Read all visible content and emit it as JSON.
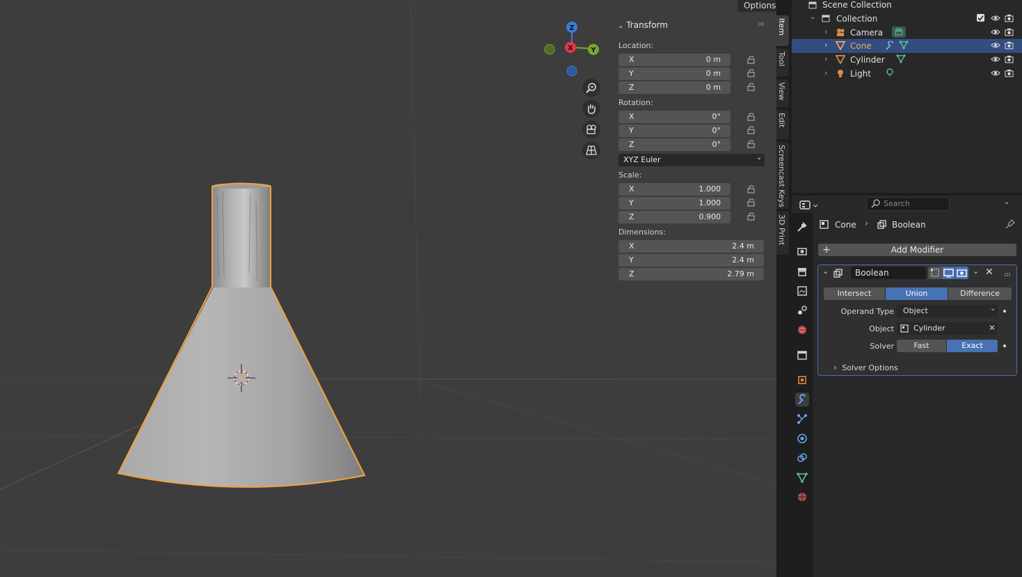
{
  "viewport": {
    "options_label": "Options",
    "gizmo": {
      "z": "Z",
      "x": "X",
      "y": "Y"
    }
  },
  "transform": {
    "title": "Transform",
    "location": {
      "label": "Location:",
      "x": "0 m",
      "y": "0 m",
      "z": "0 m"
    },
    "rotation": {
      "label": "Rotation:",
      "x": "0°",
      "y": "0°",
      "z": "0°",
      "mode": "XYZ Euler"
    },
    "scale": {
      "label": "Scale:",
      "x": "1.000",
      "y": "1.000",
      "z": "0.900"
    },
    "dimensions": {
      "label": "Dimensions:",
      "x": "2.4 m",
      "y": "2.4 m",
      "z": "2.79 m"
    },
    "axis": {
      "x": "X",
      "y": "Y",
      "z": "Z"
    }
  },
  "side_tabs": [
    "Item",
    "Tool",
    "View",
    "Edit",
    "Screencast Keys",
    "3D Print"
  ],
  "outliner": {
    "scene_collection": "Scene Collection",
    "collection": "Collection",
    "objects": [
      "Camera",
      "Cone",
      "Cylinder",
      "Light"
    ]
  },
  "properties": {
    "search_placeholder": "Search",
    "breadcrumb": {
      "object": "Cone",
      "modifier": "Boolean"
    },
    "add_modifier": "Add Modifier",
    "modifier": {
      "name": "Boolean",
      "ops": [
        "Intersect",
        "Union",
        "Difference"
      ],
      "active_op": "Union",
      "operand_type_label": "Operand Type",
      "operand_type": "Object",
      "object_label": "Object",
      "object_value": "Cylinder",
      "solver_label": "Solver",
      "solver_fast": "Fast",
      "solver_exact": "Exact",
      "solver_options": "Solver Options"
    }
  },
  "colors": {
    "accent": "#4772b3",
    "selected_row": "#334d80",
    "active_object": "#f2a65a",
    "selection_outline": "#f5a23a"
  }
}
